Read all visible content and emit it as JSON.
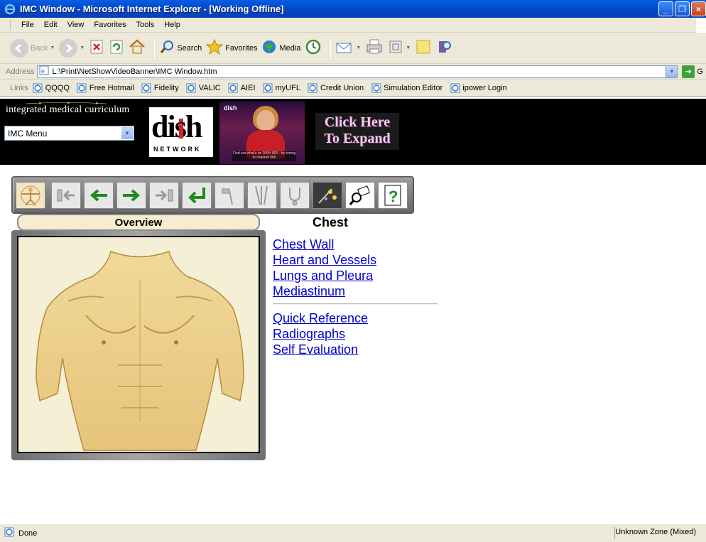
{
  "window": {
    "title": "IMC Window - Microsoft Internet Explorer - [Working Offline]",
    "minimize": "_",
    "restore": "❐",
    "close": "×"
  },
  "menu": [
    "File",
    "Edit",
    "View",
    "Favorites",
    "Tools",
    "Help"
  ],
  "toolbar": {
    "back": "Back",
    "search": "Search",
    "favorites": "Favorites",
    "media": "Media"
  },
  "address": {
    "label": "Address",
    "value": "L:\\Print\\NetShowVideoBanner\\IMC Window.htm",
    "go": "G"
  },
  "links": {
    "label": "Links",
    "items": [
      "QQQQ",
      "Free Hotmail",
      "Fidelity",
      "VALIC",
      "AIEI",
      "myUFL",
      "Credit Union",
      "Simulation Editor",
      "ipower Login"
    ]
  },
  "banner": {
    "logo_text": "integrated medical curriculum",
    "menu_select": "IMC Menu",
    "dish_word": "dish",
    "dish_network": "NETWORK",
    "video_caption": "Find out what's on DISH 800 - by tuning to channel 965",
    "expand_text": "Click Here To Expand"
  },
  "overview": {
    "tab_label": "Overview"
  },
  "chest": {
    "title": "Chest",
    "links_top": [
      "Chest Wall",
      "Heart and Vessels",
      "Lungs and Pleura",
      "Mediastinum"
    ],
    "links_bottom": [
      "Quick Reference",
      "Radiographs",
      "Self Evaluation"
    ]
  },
  "status": {
    "text": "Done",
    "zone": "Unknown Zone (Mixed)"
  },
  "colors": {
    "titlebar": "#0453d9",
    "chrome": "#ece9d8",
    "link": "#0000cc",
    "banner_bg": "#000000"
  }
}
